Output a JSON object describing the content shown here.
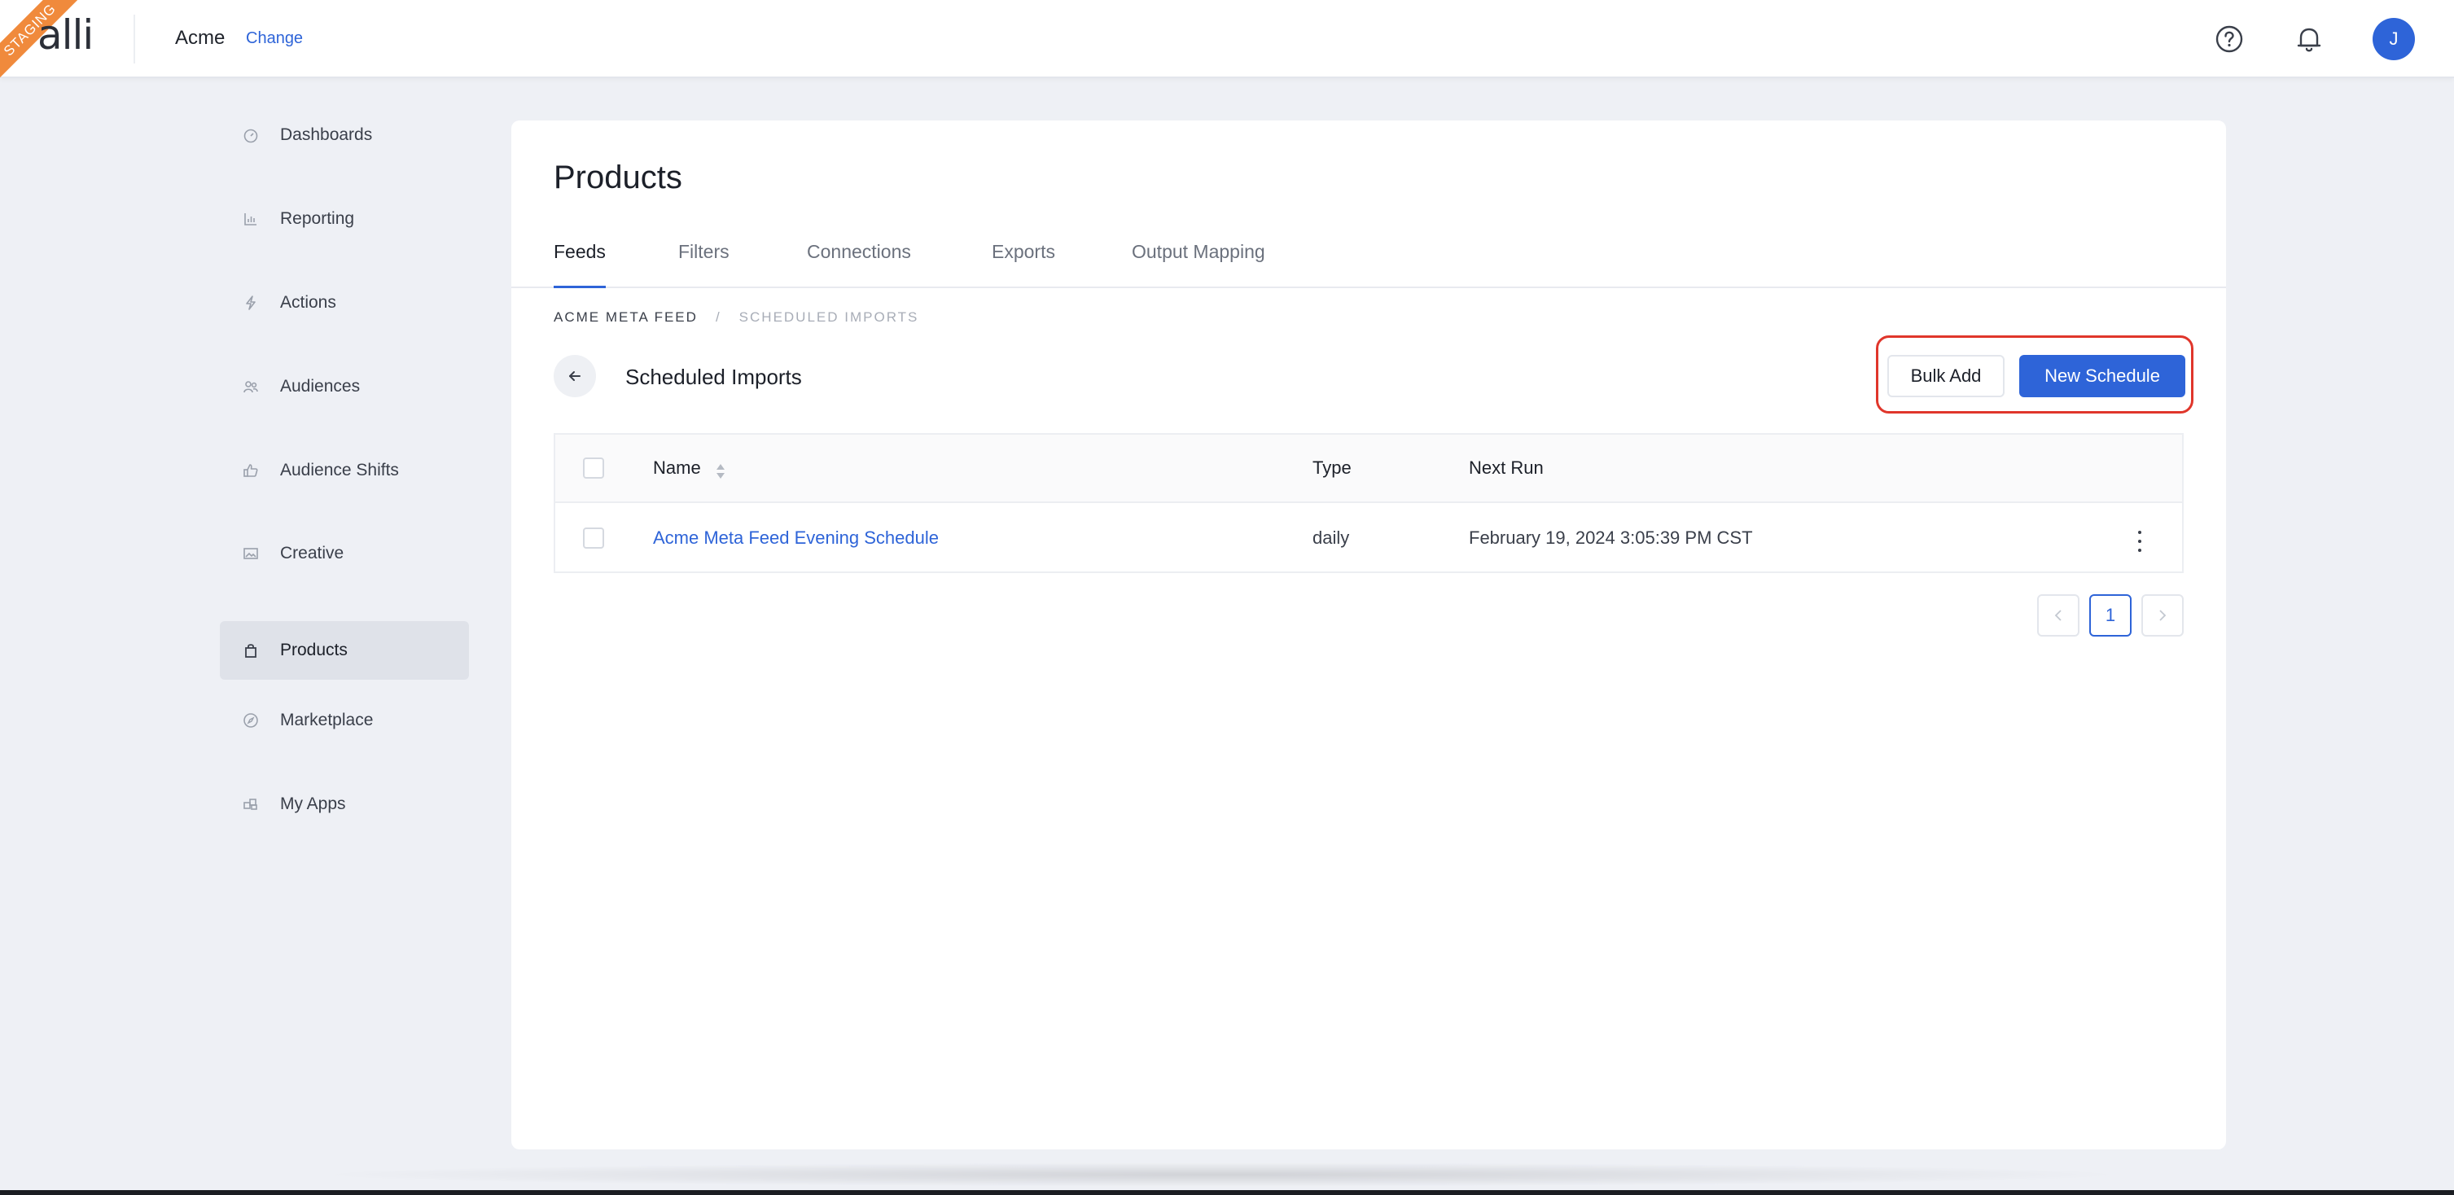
{
  "env_badge": "STAGING",
  "header": {
    "logo": "alli",
    "org_name": "Acme",
    "org_change": "Change",
    "help_icon": "help-circle-icon",
    "notifications_icon": "bell-icon",
    "avatar_initial": "J"
  },
  "sidebar": {
    "items": [
      {
        "label": "Dashboards",
        "icon": "dashboard-gauge-icon"
      },
      {
        "label": "Reporting",
        "icon": "bar-chart-icon"
      },
      {
        "label": "Actions",
        "icon": "lightning-icon"
      },
      {
        "label": "Audiences",
        "icon": "people-icon"
      },
      {
        "label": "Audience Shifts",
        "icon": "thumbs-up-icon"
      },
      {
        "label": "Creative",
        "icon": "image-icon"
      },
      {
        "label": "Products",
        "icon": "shopping-bag-icon",
        "active": true
      },
      {
        "label": "Marketplace",
        "icon": "compass-icon"
      },
      {
        "label": "My Apps",
        "icon": "apps-icon"
      }
    ]
  },
  "main": {
    "title": "Products",
    "tabs": [
      {
        "label": "Feeds",
        "active": true
      },
      {
        "label": "Filters"
      },
      {
        "label": "Connections"
      },
      {
        "label": "Exports"
      },
      {
        "label": "Output Mapping"
      }
    ],
    "breadcrumb": {
      "parent": "ACME META FEED",
      "separator": "/",
      "current": "SCHEDULED IMPORTS"
    },
    "section_title": "Scheduled Imports",
    "bulk_add_label": "Bulk Add",
    "new_schedule_label": "New Schedule"
  },
  "table": {
    "columns": {
      "name": "Name",
      "type": "Type",
      "next_run": "Next Run"
    },
    "rows": [
      {
        "name": "Acme Meta Feed Evening Schedule",
        "type": "daily",
        "next_run": "February 19, 2024 3:05:39 PM CST"
      }
    ]
  },
  "pagination": {
    "current_page": "1"
  },
  "colors": {
    "accent": "#2e64d8",
    "highlight": "#e0362b",
    "badge": "#f08a3c"
  }
}
